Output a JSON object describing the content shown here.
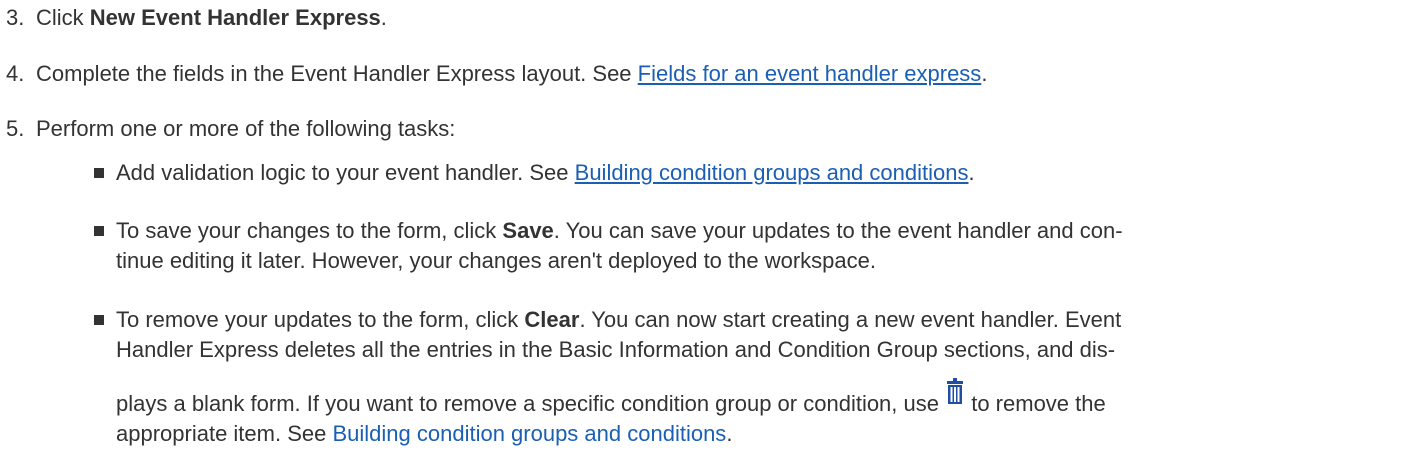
{
  "steps": [
    {
      "num": "3.",
      "pre": "Click ",
      "bold": "New Event Handler Express",
      "post": "."
    },
    {
      "num": "4.",
      "pre": "Complete the fields in the Event Handler Express layout. See ",
      "link": "Fields for an event handler express",
      "post": "."
    },
    {
      "num": "5.",
      "text": "Perform one or more of the following tasks:"
    }
  ],
  "subitems": [
    {
      "pre": "Add validation logic to your event handler. See ",
      "link": "Building condition groups and conditions",
      "post": "."
    },
    {
      "pre": "To save your changes to the form, click ",
      "bold": "Save",
      "post1": ". You can save your updates to the event handler and con-",
      "line2": "tinue editing it later. However, your changes aren't deployed to the workspace."
    },
    {
      "pre": "To remove your updates to the form, click ",
      "bold": "Clear",
      "post1": ". You can now start creating a new event handler. Event",
      "line2": "Handler Express deletes all the entries in the Basic Information and Condition Group sections, and dis-",
      "line3_pre": "plays a blank form. If you want to remove a specific condition group or condition, use ",
      "line3_post": " to remove the",
      "line4_pre": "appropriate item. See ",
      "line4_link": "Building condition groups and conditions",
      "line4_post": "."
    }
  ],
  "colors": {
    "text": "#333333",
    "link": "#1a5fb4",
    "icon": "#1f4fa3"
  }
}
